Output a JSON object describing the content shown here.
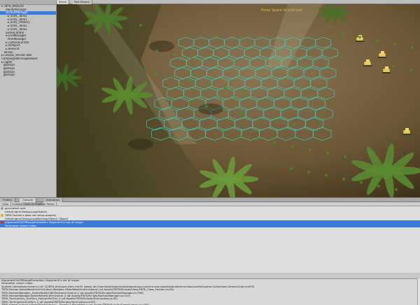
{
  "hierarchy": {
    "rows": [
      {
        "label": "▾ TBTK_HexGrid",
        "indent": 0,
        "selected": false
      },
      {
        "label": "AbilityManager",
        "indent": 2,
        "selected": false
      },
      {
        "label": "FactionManager",
        "indent": 2,
        "selected": true
      },
      {
        "label": "▸ Unit1_Tank1",
        "indent": 3,
        "selected": false
      },
      {
        "label": "▸ Unit1_Tank1",
        "indent": 3,
        "selected": false
      },
      {
        "label": "▸ Unit1_Artillery",
        "indent": 3,
        "selected": false
      },
      {
        "label": "▸ Unit1_Tank2",
        "indent": 3,
        "selected": false
      },
      {
        "label": "▸ Unit1_Tank2",
        "indent": 3,
        "selected": false
      },
      {
        "label": "GameControl",
        "indent": 2,
        "selected": false
      },
      {
        "label": "▾ GridManager",
        "indent": 2,
        "selected": false
      },
      {
        "label": "PerkManager",
        "indent": 3,
        "selected": false
      },
      {
        "label": "▸ CameraControl",
        "indent": 2,
        "selected": false
      },
      {
        "label": "▸ UIObject",
        "indent": 2,
        "selected": false
      },
      {
        "label": "▸ HexGrid",
        "indent": 2,
        "selected": false
      },
      {
        "label": "Terrain",
        "indent": 1,
        "selected": false
      },
      {
        "label": "▸ Canvas_Version.dex",
        "indent": 0,
        "selected": false
      },
      {
        "label": "CampaignWinningReward",
        "indent": 0,
        "selected": false
      },
      {
        "label": "▸ Lights",
        "indent": 0,
        "selected": false
      },
      {
        "label": "godrays",
        "indent": 1,
        "selected": false
      },
      {
        "label": "godrays",
        "indent": 1,
        "selected": false
      },
      {
        "label": "godrays",
        "indent": 1,
        "selected": false
      },
      {
        "label": "godrays",
        "indent": 1,
        "selected": false
      }
    ]
  },
  "scene": {
    "tabs": [
      "Scene",
      "Post Rework"
    ],
    "overlay_label": "Press Space to end turn"
  },
  "console": {
    "tabs": [
      {
        "label": "Profiler",
        "active": false
      },
      {
        "label": "Console",
        "active": true
      },
      {
        "label": "Animation",
        "active": false
      }
    ],
    "toolbar": [
      {
        "label": "Clear",
        "on": false
      },
      {
        "label": "Collapse",
        "on": false
      },
      {
        "label": "Clear on Play",
        "on": true
      },
      {
        "label": "Error Pause",
        "on": false
      }
    ],
    "entries": [
      {
        "text": "generated: grid",
        "type": "info"
      },
      {
        "text": "UnityEngine.Debug:Log(Object)",
        "type": "info"
      },
      {
        "text": "TBTK Faction's data not setup properly",
        "type": "warn"
      },
      {
        "text": "UnityEngine.Debug:LogWarning(Object, Object)",
        "type": "warn"
      },
      {
        "text": "ArgumentOutOfRangeException: Argument is out of range.",
        "type": "error"
      },
      {
        "text": "Parameter name: index",
        "type": "error"
      }
    ],
    "detail_lines": [
      "ArgumentOutOfRangeException: Argument is out of range.",
      "Parameter name: index",
      "System.Collections.Generic.List`1[TBTK.Unit].get_Item (Int32 index) (at /Users/builduser/buildslave/mono-runtime-and-classlibs/build/mcs/class/corlib/System.Collections.Generic/List.cs:633)",
      "TBTK.Faction.SelectNextUnitOnQueue (Boolean SelectNextUnitOnQueue) (at Assets/TBTK/Scripts/Class/TBTK_Class_Faction.cs:95)",
      "TBTK.FactionManager._SelectNextUnitInFactionOnQueue () (at Assets/TBTK/Scripts/FactionManager.cs:336)",
      "TBTK.FactionManager.SelectNextUnitOnQueue () (at Assets/TBTK/Scripts/FactionManager.cs:310)",
      "TBTK.TurnControl._EndTurn_FactionPerTurn () (at Assets/TBTK/Scripts/TurnControl.cs:93)",
      "TBTK.TurnControl.EndTurn () (at Assets/TBTK/Scripts/TurnControl.cs:67)",
      "TBTK.GameControl+<DelayStartGame>c__Iterator1.MoveNext () (at Assets/TBTK/Scripts/GameControl.cs:183)"
    ]
  },
  "colors": {
    "selection": "#3d7bd7",
    "hex_line": "#3fd6c8",
    "ground": "#6b5a3a"
  }
}
